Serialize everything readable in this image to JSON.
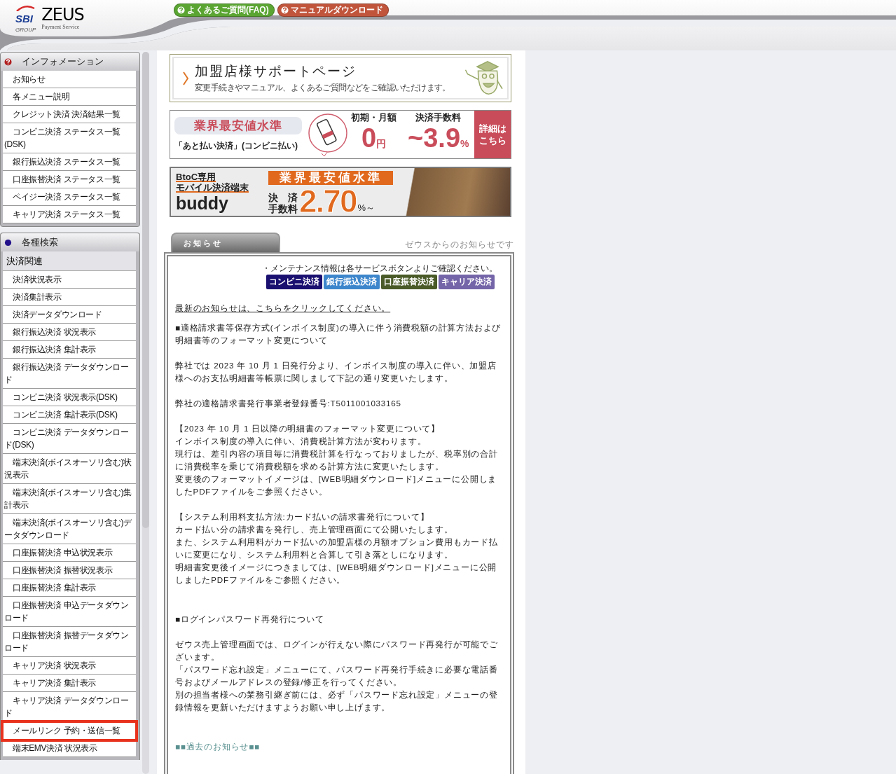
{
  "header": {
    "logo": {
      "brand": "SBI",
      "group": "GROUP",
      "name": "ZEUS",
      "tagline": "Payment Service"
    },
    "buttons": [
      {
        "label": "よくあるご質問(FAQ)",
        "color": "#5aa532"
      },
      {
        "label": "マニュアルダウンロード",
        "color": "#c0553c"
      }
    ]
  },
  "sidebar": {
    "sections": [
      {
        "title": "インフォメーション",
        "kind": "info",
        "items": [
          {
            "label": "お知らせ",
            "highlighted": false
          },
          {
            "label": "各メニュー説明",
            "highlighted": false
          },
          {
            "label": "クレジット決済 決済結果一覧",
            "highlighted": false
          },
          {
            "label": "コンビニ決済 ステータス一覧(DSK)",
            "highlighted": false
          },
          {
            "label": "銀行振込決済 ステータス一覧",
            "highlighted": false
          },
          {
            "label": "口座振替決済 ステータス一覧",
            "highlighted": false
          },
          {
            "label": "ペイジー決済 ステータス一覧",
            "highlighted": false
          },
          {
            "label": "キャリア決済 ステータス一覧",
            "highlighted": false
          }
        ]
      },
      {
        "title": "各種検索",
        "kind": "search",
        "subheading": "決済関連",
        "items": [
          {
            "label": "決済状況表示",
            "highlighted": false
          },
          {
            "label": "決済集計表示",
            "highlighted": false
          },
          {
            "label": "決済データダウンロード",
            "highlighted": false
          },
          {
            "label": "銀行振込決済 状況表示",
            "highlighted": false
          },
          {
            "label": "銀行振込決済 集計表示",
            "highlighted": false
          },
          {
            "label": "銀行振込決済 データダウンロード",
            "highlighted": false
          },
          {
            "label": "コンビニ決済 状況表示(DSK)",
            "highlighted": false
          },
          {
            "label": "コンビニ決済 集計表示(DSK)",
            "highlighted": false
          },
          {
            "label": "コンビニ決済 データダウンロード(DSK)",
            "highlighted": false
          },
          {
            "label": "端末決済(ボイスオーソリ含む)状況表示",
            "highlighted": false
          },
          {
            "label": "端末決済(ボイスオーソリ含む)集計表示",
            "highlighted": false
          },
          {
            "label": "端末決済(ボイスオーソリ含む)データダウンロード",
            "highlighted": false
          },
          {
            "label": "口座振替決済 申込状況表示",
            "highlighted": false
          },
          {
            "label": "口座振替決済 振替状況表示",
            "highlighted": false
          },
          {
            "label": "口座振替決済 集計表示",
            "highlighted": false
          },
          {
            "label": "口座振替決済 申込データダウンロード",
            "highlighted": false
          },
          {
            "label": "口座振替決済 振替データダウンロード",
            "highlighted": false
          },
          {
            "label": "キャリア決済 状況表示",
            "highlighted": false
          },
          {
            "label": "キャリア決済 集計表示",
            "highlighted": false
          },
          {
            "label": "キャリア決済 データダウンロード",
            "highlighted": false
          },
          {
            "label": "メールリンク 予約・送信一覧",
            "highlighted": true
          },
          {
            "label": "端末EMV決済 状況表示",
            "highlighted": false
          }
        ]
      }
    ]
  },
  "banners": [
    {
      "kind": "support",
      "title": "加盟店様サポートページ",
      "subtitle": "変更手続きやマニュアル、よくあるご質問などをご確認いただけます。"
    },
    {
      "kind": "atobarai",
      "badge": "業界最安値水準",
      "service": "「あと払い決済」(コンビニ払い)",
      "fee1_label": "初期・月額",
      "fee1_value": "0",
      "fee1_unit": "円",
      "fee2_label": "決済手数料",
      "fee2_value": "~3.9",
      "fee2_unit": "%",
      "cta": "詳細はこちら"
    },
    {
      "kind": "buddy",
      "line1": "BtoC専用",
      "line2": "モバイル決済端末",
      "name": "buddy",
      "badge": "業界最安値水準",
      "fee_label1": "決　済",
      "fee_label2": "手数料",
      "rate": "2.70",
      "unit": "%～"
    }
  ],
  "notice": {
    "tab": "お知らせ",
    "caption": "ゼウスからのお知らせです",
    "maintenance": "・メンテナンス情報は各サービスボタンよりご確認ください。",
    "services": [
      {
        "label": "コンビニ決済",
        "color": "#1a1070"
      },
      {
        "label": "銀行振込決済",
        "color": "#3d86cc"
      },
      {
        "label": "口座振替決済",
        "color": "#4a5a28"
      },
      {
        "label": "キャリア決済",
        "color": "#7464a8"
      }
    ],
    "latest_link": "最新のお知らせは、こちらをクリックしてください。",
    "paragraphs": [
      [
        "■適格請求書等保存方式(インボイス制度)の導入に伴う消費税額の計算方法および明細書等のフォーマット変更について"
      ],
      [
        "弊社では 2023 年 10 月 1 日発行分より、インボイス制度の導入に伴い、加盟店様へのお支払明細書等帳票に関しまして下記の通り変更いたします。"
      ],
      [
        "弊社の適格請求書発行事業者登録番号:T5011001033165"
      ],
      [
        "【2023 年 10 月 1 日以降の明細書のフォーマット変更について】",
        "インボイス制度の導入に伴い、消費税計算方法が変わります。",
        "現行は、差引内容の項目毎に消費税計算を行なっておりましたが、税率別の合計に消費税率を乗じて消費税額を求める計算方法に変更いたします。",
        "変更後のフォーマットイメージは、[WEB明細ダウンロード]メニューに公開しましたPDFファイルをご参照ください。"
      ],
      [
        "【システム利用料支払方法:カード払いの請求書発行について】",
        "カード払い分の請求書を発行し、売上管理画面にて公開いたします。",
        "また、システム利用料がカード払いの加盟店様の月額オプション費用もカード払いに変更になり、システム利用料と合算して引き落としになります。",
        "明細書変更後イメージにつきましては、[WEB明細ダウンロード]メニューに公開しましたPDFファイルをご参照ください。"
      ],
      [
        "■ログインパスワード再発行について"
      ],
      [
        "ゼウス売上管理画面では、ログインが行えない際にパスワード再発行が可能でございます。",
        "「パスワード忘れ設定」メニューにて、パスワード再発行手続きに必要な電話番号およびメールアドレスの登録/修正を行ってください。",
        "別の担当者様への業務引継ぎ前には、必ず「パスワード忘れ設定」メニューの登録情報を更新いただけますようお願い申し上げます。"
      ]
    ],
    "past_link": "■■過去のお知らせ■■"
  }
}
